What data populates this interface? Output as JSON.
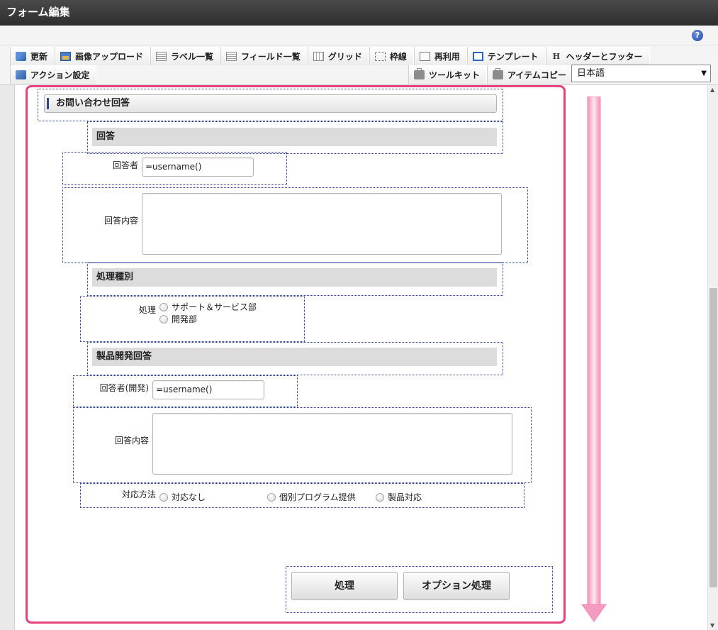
{
  "window": {
    "title": "フォーム編集"
  },
  "toolbar": {
    "row1": [
      {
        "label": "更新",
        "icon": "update-icon"
      },
      {
        "label": "画像アップロード",
        "icon": "image-upload-icon"
      },
      {
        "label": "ラベル一覧",
        "icon": "label-list-icon"
      },
      {
        "label": "フィールド一覧",
        "icon": "field-list-icon"
      },
      {
        "label": "グリッド",
        "icon": "grid-icon"
      },
      {
        "label": "枠線",
        "icon": "border-icon"
      },
      {
        "label": "再利用",
        "icon": "reuse-icon"
      },
      {
        "label": "テンプレート",
        "icon": "template-icon"
      },
      {
        "label": "ヘッダーとフッター",
        "icon": "header-footer-icon"
      }
    ],
    "action_label": "アクション設定",
    "toolkit_label": "ツールキット",
    "item_copy_label": "アイテムコピー",
    "language": "日本語"
  },
  "form": {
    "title": "お問い合わせ回答",
    "section_answer": "回答",
    "answerer_label": "回答者",
    "answerer_value": "=username()",
    "answer_content_label": "回答内容",
    "section_processing": "処理種別",
    "processing_label": "処理",
    "processing_options": [
      "サポート＆サービス部",
      "開発部"
    ],
    "section_dev": "製品開発回答",
    "dev_answerer_label": "回答者(開発)",
    "dev_answerer_value": "=username()",
    "dev_content_label": "回答内容",
    "method_label": "対応方法",
    "method_options": [
      "対応なし",
      "個別プログラム提供",
      "製品対応"
    ],
    "process_button": "処理",
    "option_button": "オプション処理"
  },
  "colors": {
    "highlight": "#e8417e",
    "arrow": "#f7a8c8",
    "titlebar": "#3a3a3a"
  }
}
